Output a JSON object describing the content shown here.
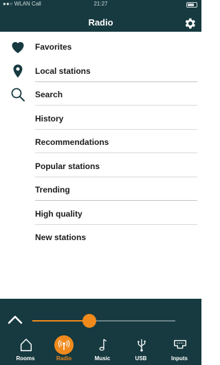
{
  "status_bar": {
    "carrier": "●●○ WLAN Call",
    "time": "21:27"
  },
  "header": {
    "title": "Radio"
  },
  "menu": {
    "items": [
      {
        "label": "Favorites",
        "icon": "heart-icon"
      },
      {
        "label": "Local stations",
        "icon": "location-pin-icon"
      },
      {
        "label": "Search",
        "icon": "search-icon"
      },
      {
        "label": "History"
      },
      {
        "label": "Recommendations"
      },
      {
        "label": "Popular stations"
      },
      {
        "label": "Trending"
      },
      {
        "label": "High quality"
      },
      {
        "label": "New stations"
      }
    ]
  },
  "player": {
    "volume_fraction": 0.4
  },
  "tabs": [
    {
      "label": "Rooms",
      "icon": "home-icon"
    },
    {
      "label": "Radio",
      "icon": "radio-icon",
      "active": true
    },
    {
      "label": "Music",
      "icon": "music-note-icon"
    },
    {
      "label": "USB",
      "icon": "usb-icon"
    },
    {
      "label": "Inputs",
      "icon": "input-icon"
    }
  ],
  "colors": {
    "header_bg": "#163a40",
    "accent": "#f08a1d",
    "text": "#1b1b1b"
  }
}
